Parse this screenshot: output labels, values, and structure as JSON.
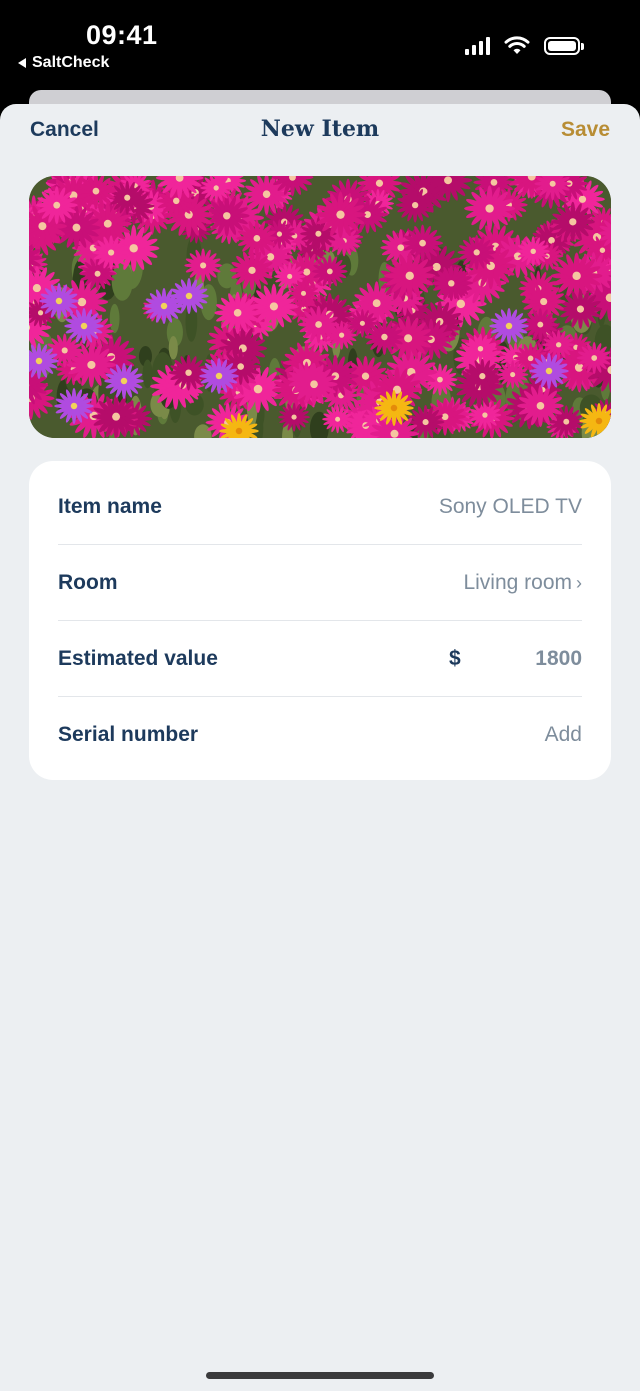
{
  "status_bar": {
    "time": "09:41",
    "back_app": "SaltCheck"
  },
  "nav": {
    "cancel_label": "Cancel",
    "title": "New Item",
    "save_label": "Save"
  },
  "colors": {
    "navy": "#1d3a5c",
    "gold": "#b88d35",
    "muted": "#7e8d9c",
    "background": "#eceff2"
  },
  "form": {
    "item_name": {
      "label": "Item name",
      "value": "Sony OLED TV"
    },
    "room": {
      "label": "Room",
      "value": "Living room",
      "chevron": "›"
    },
    "estimated_value": {
      "label": "Estimated value",
      "currency": "$",
      "amount": "1800"
    },
    "serial_number": {
      "label": "Serial number",
      "value": "Add"
    }
  },
  "icons": [
    "back-triangle-icon",
    "cellular-signal-icon",
    "wifi-icon",
    "battery-icon",
    "chevron-right-icon"
  ]
}
